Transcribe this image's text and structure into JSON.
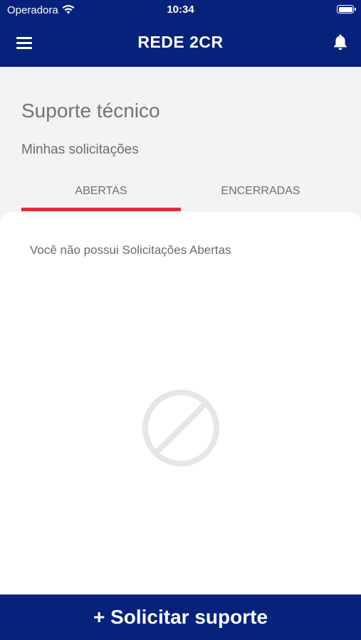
{
  "status_bar": {
    "carrier": "Operadora",
    "time": "10:34"
  },
  "app_bar": {
    "title": "REDE 2CR",
    "menu_icon": "hamburger-menu-icon",
    "notification_icon": "bell-icon"
  },
  "header": {
    "title": "Suporte técnico",
    "subtitle": "Minhas solicitações"
  },
  "tabs": [
    {
      "label": "ABERTAS",
      "selected": true
    },
    {
      "label": "ENCERRADAS",
      "selected": false
    }
  ],
  "content": {
    "empty_message": "Você não possui Solicitações Abertas",
    "empty_icon": "prohibited-icon"
  },
  "footer": {
    "action_label": "+ Solicitar suporte"
  },
  "colors": {
    "primary": "#07227a",
    "accent": "#e32b36",
    "background": "#f4f3f4"
  }
}
